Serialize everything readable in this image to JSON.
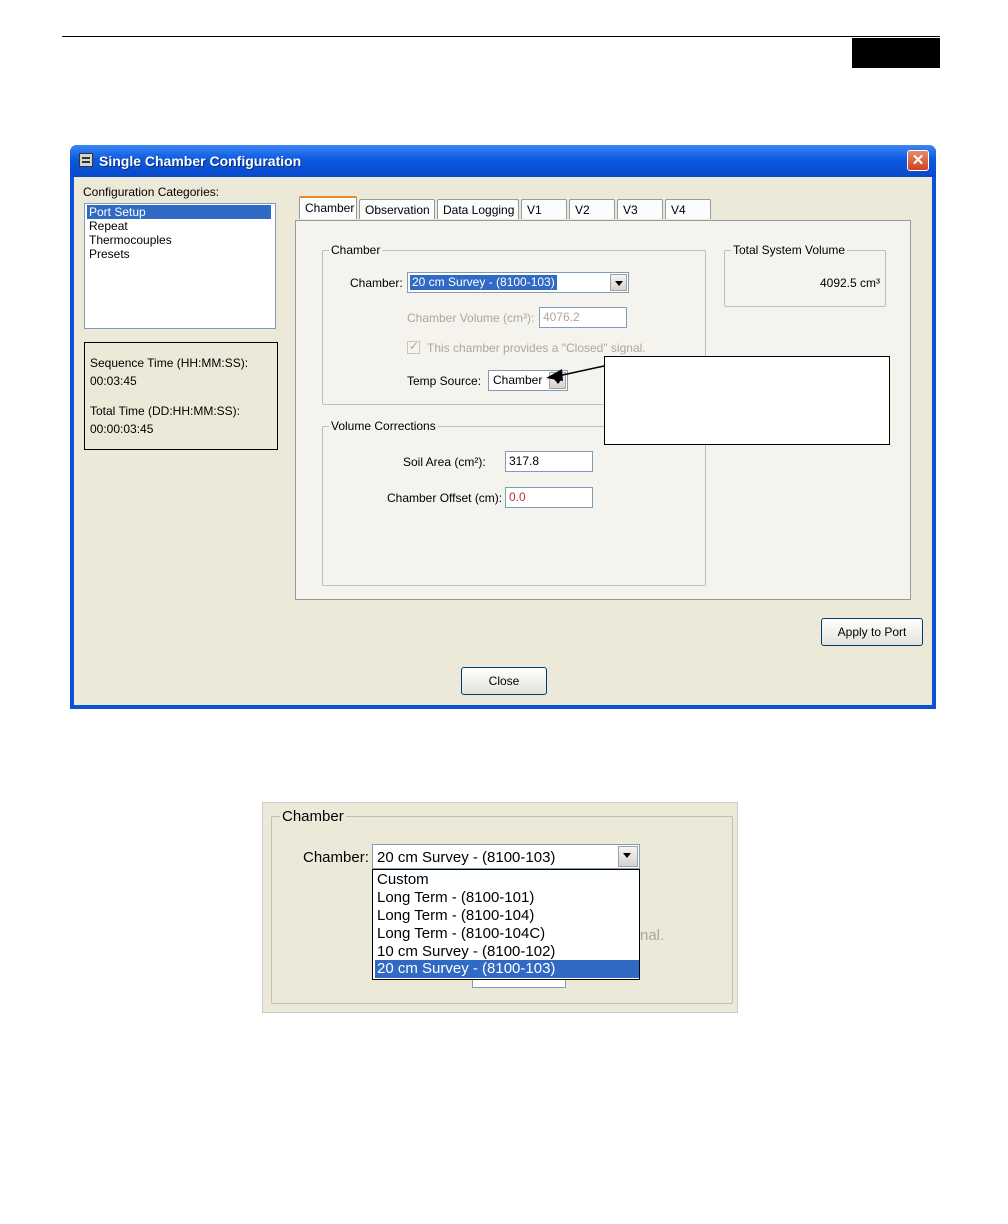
{
  "window": {
    "title": "Single Chamber Configuration",
    "close_glyph": "✕"
  },
  "categories": {
    "label": "Configuration Categories:",
    "items": [
      "Port Setup",
      "Repeat",
      "Thermocouples",
      "Presets"
    ],
    "selected": "Port Setup"
  },
  "times": {
    "sequence_label": "Sequence Time (HH:MM:SS):",
    "sequence_value": "00:03:45",
    "total_label": "Total Time (DD:HH:MM:SS):",
    "total_value": "00:00:03:45"
  },
  "tabs": [
    "Chamber",
    "Observation",
    "Data Logging",
    "V1",
    "V2",
    "V3",
    "V4"
  ],
  "active_tab": "Chamber",
  "chamber_group": {
    "title": "Chamber",
    "chamber_label": "Chamber:",
    "chamber_value": "20 cm Survey - (8100-103)",
    "volume_label": "Chamber Volume (cm³):",
    "volume_value": "4076.2",
    "closed_signal_label": "This chamber provides a \"Closed\" signal.",
    "temp_source_label": "Temp Source:",
    "temp_source_value": "Chamber"
  },
  "total_volume": {
    "title": "Total System Volume",
    "value": "4092.5 cm³"
  },
  "volume_corrections": {
    "title": "Volume Corrections",
    "soil_area_label": "Soil Area (cm²):",
    "soil_area_value": "317.8",
    "offset_label": "Chamber Offset (cm):",
    "offset_value": "0.0"
  },
  "buttons": {
    "apply": "Apply to Port",
    "close": "Close"
  },
  "inset": {
    "group_title": "Chamber",
    "chamber_label": "Chamber:",
    "chamber_value": "20 cm Survey - (8100-103)",
    "options": [
      "Custom",
      "Long Term - (8100-101)",
      "Long Term - (8100-104)",
      "Long Term - (8100-104C)",
      "10 cm Survey - (8100-102)",
      "20 cm Survey - (8100-103)"
    ],
    "selected_index": 5,
    "partial_text": "nal."
  },
  "colors": {
    "titlebar": "#0b5ae0",
    "selection": "#316ac5",
    "offset_text": "#c0303a"
  }
}
